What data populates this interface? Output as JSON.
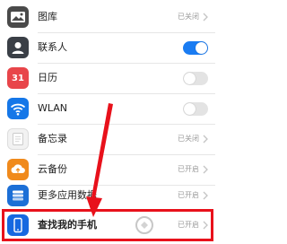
{
  "rows": [
    {
      "label": "图库",
      "status": "已关闭",
      "icon": "gallery-icon",
      "icon_color": "#4a4a4a"
    },
    {
      "label": "联系人",
      "toggle": "on",
      "icon": "contacts-icon",
      "icon_color": "#3a3f46"
    },
    {
      "label": "日历",
      "toggle": "off",
      "icon": "calendar-icon",
      "icon_color": "#e8454a",
      "icon_text": "31"
    },
    {
      "label": "WLAN",
      "toggle": "off",
      "icon": "wifi-icon",
      "icon_color": "#1577e8"
    },
    {
      "label": "备忘录",
      "status": "已关闭",
      "icon": "notes-icon",
      "icon_color": "#f2f2f2"
    },
    {
      "label": "云备份",
      "status": "已开启",
      "icon": "cloud-backup-icon",
      "icon_color": "#f08a1c"
    },
    {
      "label": "更多应用数据",
      "status": "已开启",
      "icon": "more-app-data-icon",
      "icon_color": "#1c6fd6"
    },
    {
      "label": "查找我的手机",
      "status": "已开启",
      "icon": "find-my-phone-icon",
      "icon_color": "#1668e0"
    }
  ],
  "colors": {
    "accent": "#1a7cf2",
    "highlight": "#e8111b"
  }
}
